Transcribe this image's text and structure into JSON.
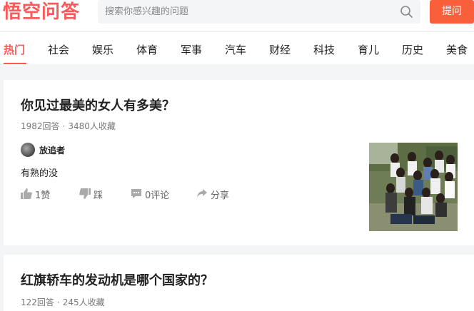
{
  "header": {
    "logo_text": "悟空问答",
    "search_placeholder": "搜索你感兴趣的问题",
    "ask_label": "提问"
  },
  "nav": {
    "items": [
      {
        "label": "热门",
        "active": true
      },
      {
        "label": "社会"
      },
      {
        "label": "娱乐"
      },
      {
        "label": "体育"
      },
      {
        "label": "军事"
      },
      {
        "label": "汽车"
      },
      {
        "label": "财经"
      },
      {
        "label": "科技"
      },
      {
        "label": "育儿"
      },
      {
        "label": "历史"
      },
      {
        "label": "美食"
      }
    ]
  },
  "questions": [
    {
      "title": "你见过最美的女人有多美？",
      "answers": "1982回答",
      "favorites": "3480人收藏",
      "author": "放追者",
      "excerpt": "有熟的没",
      "likes": "1赞",
      "dislike_label": "踩",
      "comments": "0评论",
      "share_label": "分享"
    },
    {
      "title": "红旗轿车的发动机是哪个国家的？",
      "answers": "122回答",
      "favorites": "245人收藏"
    }
  ],
  "colors": {
    "accent": "#f85959",
    "ask_button": "#f85f3a",
    "background": "#f4f5f6"
  },
  "icons": {
    "like": "thumbs-up-icon",
    "dislike": "thumbs-down-icon",
    "comment": "comment-icon",
    "share": "share-icon",
    "search": "search-icon"
  }
}
